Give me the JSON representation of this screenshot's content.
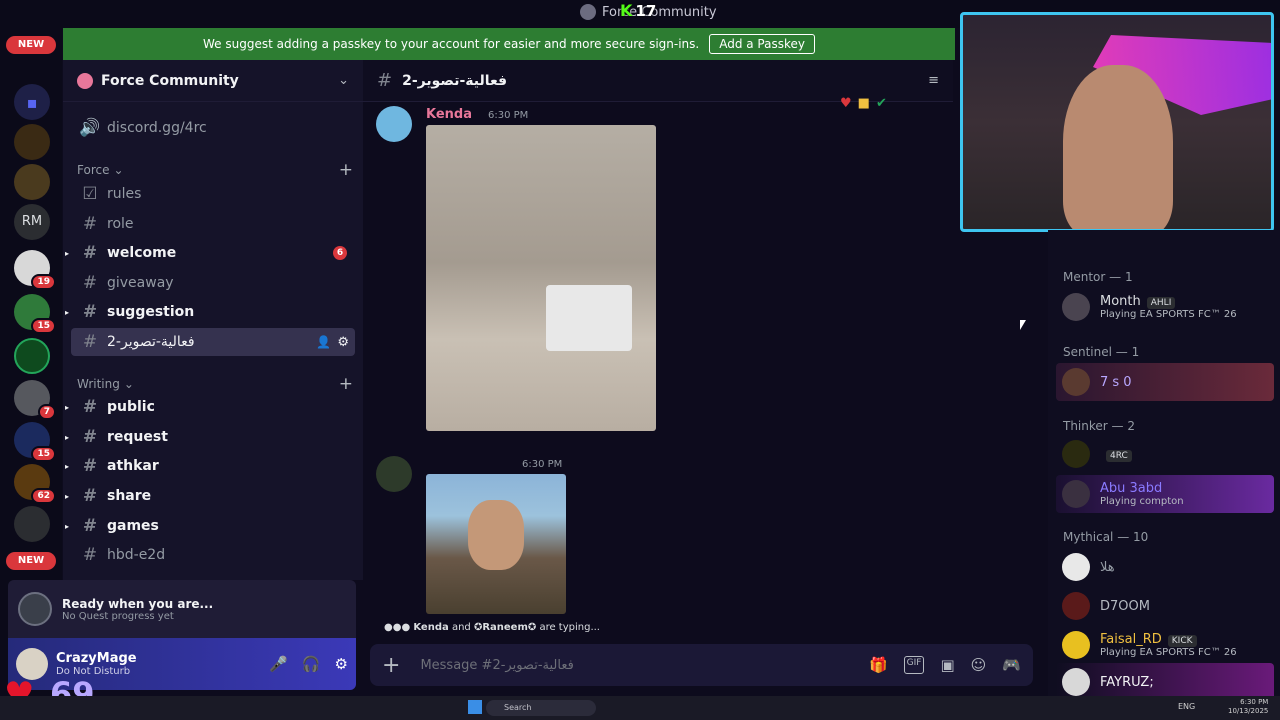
{
  "window": {
    "title": "Force Community",
    "viewer_count": "17"
  },
  "banner": {
    "text": "We suggest adding a passkey to your account for easier and more secure sign-ins.",
    "button": "Add a Passkey"
  },
  "rail": {
    "new_label": "NEW",
    "new_label_bottom": "NEW",
    "rm_label": "RM",
    "badges": [
      "19",
      "15",
      "7",
      "15",
      "62"
    ]
  },
  "server": {
    "name": "Force Community"
  },
  "channels_top": [
    {
      "label": "discord.gg/4rc"
    }
  ],
  "categories": [
    {
      "name": "Force"
    },
    {
      "name": "Writing"
    }
  ],
  "force_channels": [
    {
      "label": "rules"
    },
    {
      "label": "role"
    },
    {
      "label": "welcome",
      "badge": "6"
    },
    {
      "label": "giveaway"
    },
    {
      "label": "suggestion"
    },
    {
      "label": "فعالية-تصوير-2"
    }
  ],
  "writing_channels": [
    {
      "label": "public"
    },
    {
      "label": "request"
    },
    {
      "label": "athkar"
    },
    {
      "label": "share"
    },
    {
      "label": "games"
    },
    {
      "label": "hbd-e2d"
    }
  ],
  "quest": {
    "title": "Ready when you are...",
    "subtitle": "No Quest progress yet"
  },
  "user": {
    "name": "CrazyMage",
    "status": "Do Not Disturb"
  },
  "stream_overlay": {
    "likes": "69"
  },
  "chat": {
    "channel": "فعالية-تصوير-2",
    "messages": [
      {
        "author": "Kenda",
        "time": "6:30 PM",
        "author_color": "#e8779a"
      },
      {
        "author": "",
        "time": "6:30 PM"
      }
    ],
    "typing": {
      "user1": "Kenda",
      "middle": "and",
      "user2": "✪Raneem✪",
      "suffix": "are typing..."
    }
  },
  "composer": {
    "placeholder": "Message #فعالية-تصوير-2",
    "gif": "GIF"
  },
  "members": {
    "groups": [
      {
        "header": "Mentor — 1",
        "members": [
          {
            "name": "Month",
            "tag": "AHLI",
            "activity": "Playing EA SPORTS FC™ 26"
          }
        ]
      },
      {
        "header": "Sentinel — 1",
        "members": [
          {
            "name": "7 s 0",
            "activity": ""
          }
        ]
      },
      {
        "header": "Thinker — 2",
        "members": [
          {
            "name": "",
            "tag": "4RC",
            "activity": ""
          },
          {
            "name": "Abu 3abd",
            "activity": "Playing compton"
          }
        ]
      },
      {
        "header": "Mythical — 10",
        "members": [
          {
            "name": "هلا",
            "activity": ""
          },
          {
            "name": "D7OOM",
            "activity": ""
          },
          {
            "name": "Faisal_RD",
            "tag": "KICK",
            "activity": "Playing EA SPORTS FC™ 26"
          },
          {
            "name": "FAYRUZ;",
            "activity": ""
          }
        ]
      }
    ]
  },
  "taskbar": {
    "search": "Search",
    "time": "6:30 PM",
    "date": "10/13/2025",
    "lang": "ENG"
  },
  "colors": {
    "accent": "#5865f2",
    "banner": "#2d7d32",
    "dnd": "#da373c",
    "online": "#23a55a"
  }
}
